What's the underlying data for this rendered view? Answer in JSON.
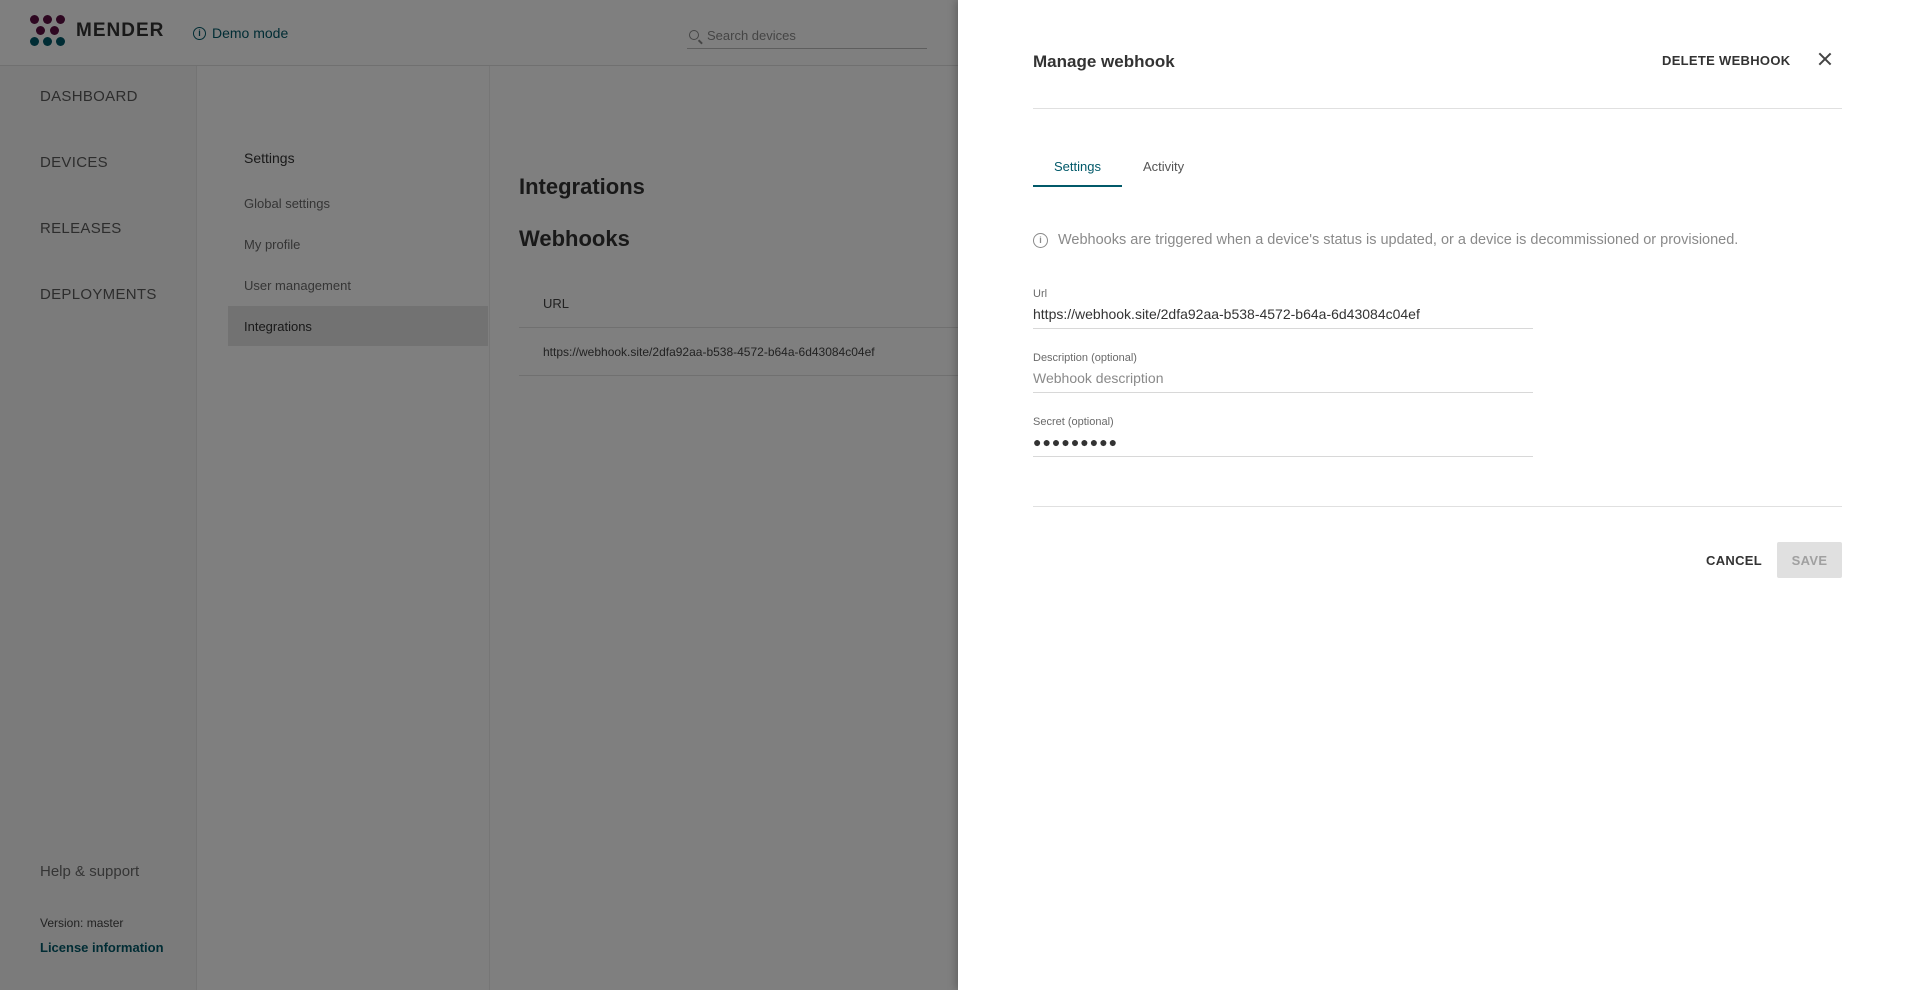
{
  "header": {
    "logo_text": "MENDER",
    "demo_mode": "Demo mode",
    "search_placeholder": "Search devices"
  },
  "main_nav": {
    "items": [
      "DASHBOARD",
      "DEVICES",
      "RELEASES",
      "DEPLOYMENTS"
    ],
    "help": "Help & support",
    "version": "Version: master",
    "license": "License information"
  },
  "settings_nav": {
    "heading": "Settings",
    "items": [
      "Global settings",
      "My profile",
      "User management",
      "Integrations"
    ],
    "active": "Integrations"
  },
  "content": {
    "title": "Integrations",
    "section": "Webhooks",
    "table": {
      "header": "URL",
      "rows": [
        "https://webhook.site/2dfa92aa-b538-4572-b64a-6d43084c04ef"
      ]
    }
  },
  "drawer": {
    "title": "Manage webhook",
    "delete_label": "DELETE WEBHOOK",
    "tabs": [
      "Settings",
      "Activity"
    ],
    "active_tab": "Settings",
    "notice": "Webhooks are triggered when a device's status is updated, or a device is decommissioned or provisioned.",
    "fields": {
      "url": {
        "label": "Url",
        "value": "https://webhook.site/2dfa92aa-b538-4572-b64a-6d43084c04ef"
      },
      "description": {
        "label": "Description (optional)",
        "placeholder": "Webhook description",
        "value": ""
      },
      "secret": {
        "label": "Secret (optional)",
        "value": "●●●●●●●●●"
      }
    },
    "cancel_label": "CANCEL",
    "save_label": "SAVE"
  },
  "colors": {
    "accent": "#015969",
    "brand_dark": "#5d0f43",
    "overlay": "rgba(0,0,0,0.5)"
  }
}
